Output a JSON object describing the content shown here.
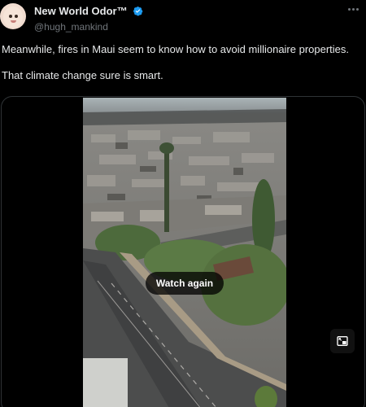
{
  "author": {
    "display_name": "New World Odor™",
    "handle": "@hugh_mankind",
    "verified": true
  },
  "tweet": {
    "lines": [
      "Meanwhile, fires in Maui seem to know how to avoid millionaire properties.",
      "That climate change sure is smart."
    ]
  },
  "video": {
    "watch_again_label": "Watch again"
  },
  "icons": {
    "verified": "verified-badge-icon",
    "more": "more-options-icon",
    "pip": "picture-in-picture-icon"
  },
  "colors": {
    "accent": "#1d9bf0",
    "text": "#e7e9ea",
    "muted": "#71767b",
    "background": "#000000"
  }
}
